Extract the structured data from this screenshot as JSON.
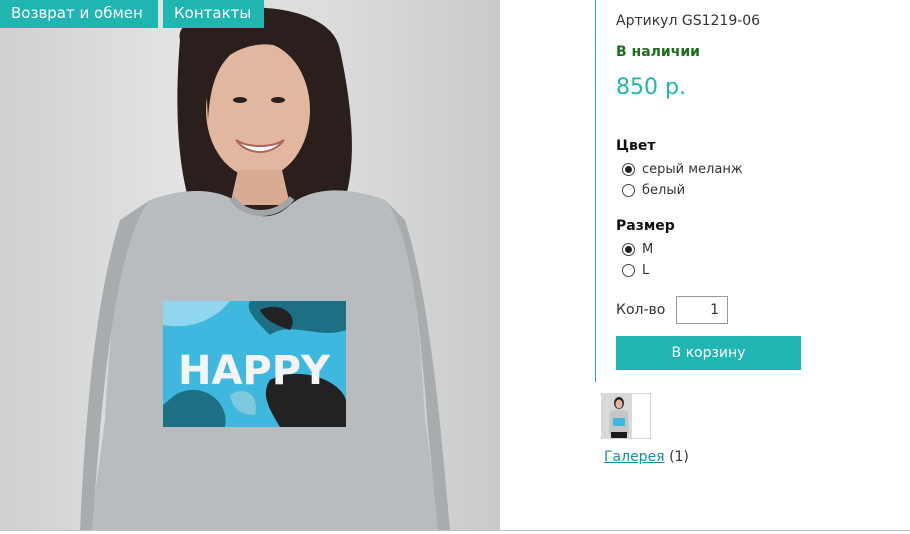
{
  "nav": {
    "returns_tab": "Возврат и обмен",
    "contacts_tab": "Контакты"
  },
  "product": {
    "sku": "Артикул GS1219-06",
    "availability": "В наличии",
    "price": "850 р.",
    "print_text": "HAPPY"
  },
  "color": {
    "title": "Цвет",
    "options": [
      {
        "label": "серый меланж",
        "selected": true
      },
      {
        "label": "белый",
        "selected": false
      }
    ]
  },
  "size": {
    "title": "Размер",
    "options": [
      {
        "label": "M",
        "selected": true
      },
      {
        "label": "L",
        "selected": false
      }
    ]
  },
  "quantity": {
    "label": "Кол-во",
    "value": "1"
  },
  "cart": {
    "button_label": "В корзину"
  },
  "gallery": {
    "link_label": "Галерея",
    "count": "(1)"
  },
  "colors": {
    "accent": "#1fb5b0",
    "in_stock": "#1f6e1f",
    "link": "#1a8aa8"
  }
}
